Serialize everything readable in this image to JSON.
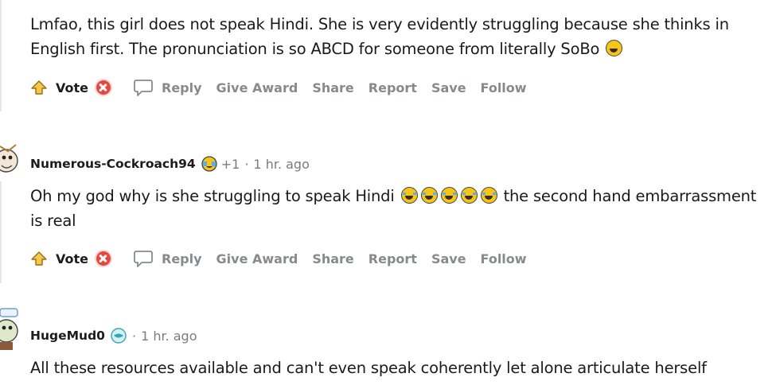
{
  "comments": [
    {
      "text": "Lmfao, this girl does not speak Hindi. She is very evidently struggling because she thinks in English first. The pronunciation is so ABCD for someone from literally SoBo",
      "emoji": "face-with-tears-of-joy",
      "actions": {
        "vote_label": "Vote",
        "reply": "Reply",
        "give_award": "Give Award",
        "share": "Share",
        "report": "Report",
        "save": "Save",
        "follow": "Follow"
      }
    },
    {
      "username": "Numerous-Cockroach94",
      "flair_icon": "crying-emoji-flair",
      "karma": "+1",
      "separator": "·",
      "time": "1 hr. ago",
      "text_before": "Oh my god why is she struggling to speak Hindi",
      "emoji_count": 5,
      "emoji": "loudly-crying-face",
      "text_after": "the second hand embarrassment is real",
      "actions": {
        "vote_label": "Vote",
        "reply": "Reply",
        "give_award": "Give Award",
        "share": "Share",
        "report": "Report",
        "save": "Save",
        "follow": "Follow"
      }
    },
    {
      "username": "HugeMud0",
      "flair_icon": "globe-flair",
      "separator": "·",
      "time": "1 hr. ago",
      "text": "All these resources available and can't even speak coherently let alone articulate herself"
    }
  ],
  "colors": {
    "upvote": "#f4c84a",
    "downvote": "#e8473f",
    "muted": "#878a8c",
    "thread_line": "#e5e7ea"
  }
}
